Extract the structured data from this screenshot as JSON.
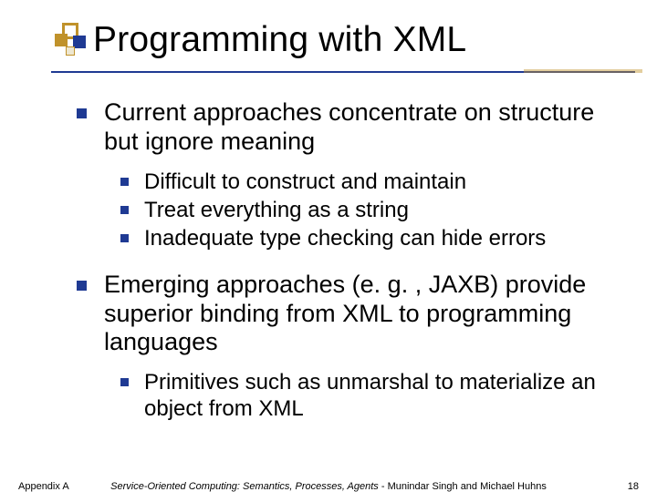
{
  "title": "Programming with XML",
  "bullets": {
    "b1": "Current approaches concentrate on structure but ignore meaning",
    "b1a": "Difficult to construct and maintain",
    "b1b": "Treat everything as a string",
    "b1c": "Inadequate type checking can hide errors",
    "b2": "Emerging approaches (e. g. , JAXB) provide superior binding from XML to programming languages",
    "b2a": "Primitives such as unmarshal to materialize an object from XML"
  },
  "footer": {
    "left": "Appendix A",
    "center_italic": "Service-Oriented Computing: Semantics, Processes, Agents",
    "center_rest": " - Munindar Singh and Michael Huhns",
    "right": "18"
  }
}
